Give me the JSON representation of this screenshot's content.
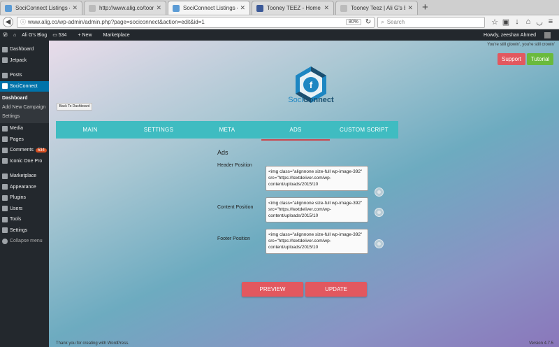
{
  "browser": {
    "tabs": [
      {
        "title": "SociConnect Listings ‹ Ali G's",
        "favicon": "page-icon",
        "active": false
      },
      {
        "title": "http://www.alig.co/tooneyte",
        "favicon": "blank-page-icon",
        "active": false
      },
      {
        "title": "SociConnect Listings ‹ Ali G's",
        "favicon": "page-icon",
        "active": true
      },
      {
        "title": "Tooney TEEZ - Home",
        "favicon": "facebook-icon",
        "active": false
      },
      {
        "title": "Tooney Teez | Ali G's Blog",
        "favicon": "blank-page-icon",
        "active": false
      }
    ],
    "url": "www.alig.co/wp-admin/admin.php?page=sociconnect&action=edit&id=1",
    "zoom": "80%",
    "search_placeholder": "Search"
  },
  "adminbar": {
    "site": "Ali G's Blog",
    "comments": "534",
    "new": "New",
    "marketplace": "Marketplace",
    "howdy": "Howdy, zeeshan Ahmed"
  },
  "sidebar": {
    "items_top": [
      {
        "label": "Dashboard",
        "icon": "dashboard-icon"
      },
      {
        "label": "Jetpack",
        "icon": "jetpack-icon"
      }
    ],
    "items_mid": [
      {
        "label": "Posts",
        "icon": "pin-icon"
      }
    ],
    "active": {
      "label": "SociConnect",
      "icon": "sociconnect-icon"
    },
    "submenu": [
      "Dashboard",
      "Add New Campaign",
      "Settings"
    ],
    "items_bottom": [
      {
        "label": "Media",
        "icon": "media-icon"
      },
      {
        "label": "Pages",
        "icon": "pages-icon"
      },
      {
        "label": "Comments",
        "icon": "comments-icon",
        "badge": "534"
      },
      {
        "label": "Iconic One Pro",
        "icon": "theme-icon"
      },
      {
        "label": "Marketplace",
        "icon": "grid-icon"
      },
      {
        "label": "Appearance",
        "icon": "brush-icon"
      },
      {
        "label": "Plugins",
        "icon": "plugin-icon"
      },
      {
        "label": "Users",
        "icon": "users-icon"
      },
      {
        "label": "Tools",
        "icon": "wrench-icon"
      },
      {
        "label": "Settings",
        "icon": "settings-icon"
      },
      {
        "label": "Collapse menu",
        "icon": "collapse-icon"
      }
    ]
  },
  "main": {
    "top_message": "You're still glowin', you're still crowin'",
    "support": "Support",
    "tutorial": "Tutorial",
    "logo_text_a": "Soci",
    "logo_text_b": "Connect",
    "back": "Back To Dashboard",
    "tabs": [
      "MAIN",
      "SETTINGS",
      "META",
      "ADS",
      "CUSTOM SCRIPT"
    ],
    "active_tab": "ADS",
    "section_title": "Ads",
    "fields": [
      {
        "label": "Header Position",
        "value": "<img class=\"alignnone size-full wp-image-392\" src=\"https://textdeliver.com/wp-content/uploads/2015/10"
      },
      {
        "label": "Content Position",
        "value": "<img class=\"alignnone size-full wp-image-392\" src=\"https://textdeliver.com/wp-content/uploads/2015/10"
      },
      {
        "label": "Footer Position",
        "value": "<img class=\"alignnone size-full wp-image-392\" src=\"https://textdeliver.com/wp-content/uploads/2015/10"
      }
    ],
    "preview": "PREVIEW",
    "update": "UPDATE",
    "footer_left": "Thank you for creating with WordPress.",
    "footer_right": "Version 4.7.5"
  }
}
